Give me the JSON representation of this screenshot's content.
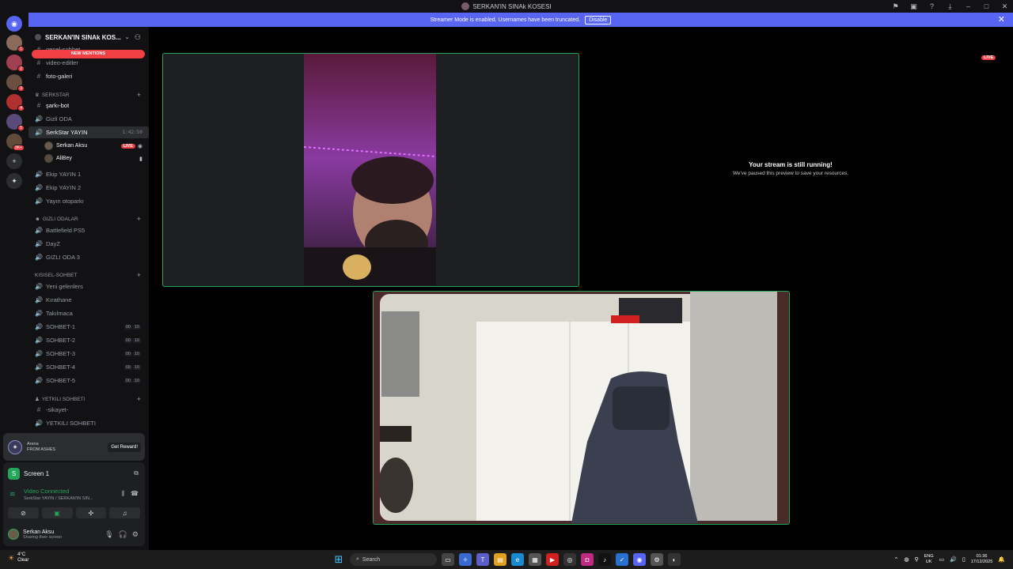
{
  "window": {
    "title": "SERKAN'IN SINAk KOSESI"
  },
  "banner": {
    "text": "Streamer Mode is enabled. Usernames have been truncated.",
    "button": "Disable"
  },
  "server": {
    "name": "SERKAN'IN SINAk KOS...",
    "mentions_pill": "NEW MENTIONS",
    "top_channels": [
      "genel-sohbet",
      "video-editler",
      "foto-galeri"
    ],
    "categories": {
      "serkstar": "SERKSTAR",
      "gizli": "GIZLI ODALAR",
      "kisisel": "KISISEL-SOHBET",
      "yetkili": "YETKILI SOHBETI"
    },
    "channels": {
      "sarki_bot": "şarkı-bot",
      "gizli_oda": "Gizli ODA",
      "serkstar_yayin": "SerkStar YAYIN",
      "timer": "1:42:50",
      "ekip1": "Ekip YAYIN 1",
      "ekip2": "Ekip YAYIN 2",
      "yayin_otoparki": "Yayın otoparkı",
      "battlefield": "Battlefield PS5",
      "dayz": "DayZ",
      "gizli3": "GIZLI ODA 3",
      "yeni_gelenler": "Yeni gelenlers",
      "kirathane": "Kırathane",
      "takilmaca": "Takılmaca",
      "sohbet1": "SOHBET-1",
      "sohbet2": "SOHBET-2",
      "sohbet3": "SOHBET-3",
      "sohbet4": "SOHBET-4",
      "sohbet5": "SOHBET-5",
      "sikayet": "-sikayet-",
      "yetkili_sohbet": "YETKILI SOHBETI"
    },
    "counts": {
      "a": "00",
      "b": "10"
    },
    "voice_users": [
      {
        "name": "Serkan Aksu",
        "live": "LIVE"
      },
      {
        "name": "AliBey"
      }
    ]
  },
  "rail": {
    "badges": [
      "1",
      "2",
      "3",
      "4",
      "5",
      "3K+"
    ]
  },
  "promo": {
    "title_line1": "Arena",
    "title_line2": "FROM ASHES",
    "button": "Get Reward!"
  },
  "voice_panel": {
    "screen_name": "Screen 1",
    "status": "Video Connected",
    "sub": "SerkStar YAYIN / SERKAN'IN SIN...",
    "me_name": "Serkan Aksu",
    "me_status": "Sharing their screen"
  },
  "stage": {
    "live_badge": "LIVE",
    "paused_title": "Your stream is still running!",
    "paused_sub": "We've paused this preview to save your resources."
  },
  "taskbar": {
    "temp": "4°C",
    "weather": "Clear",
    "search": "Search",
    "lang1": "ENG",
    "lang2": "UK",
    "time": "01:36",
    "date": "17/12/2025"
  },
  "colors": {
    "accent": "#5865f2",
    "green": "#23a55a",
    "red": "#f23f43"
  }
}
